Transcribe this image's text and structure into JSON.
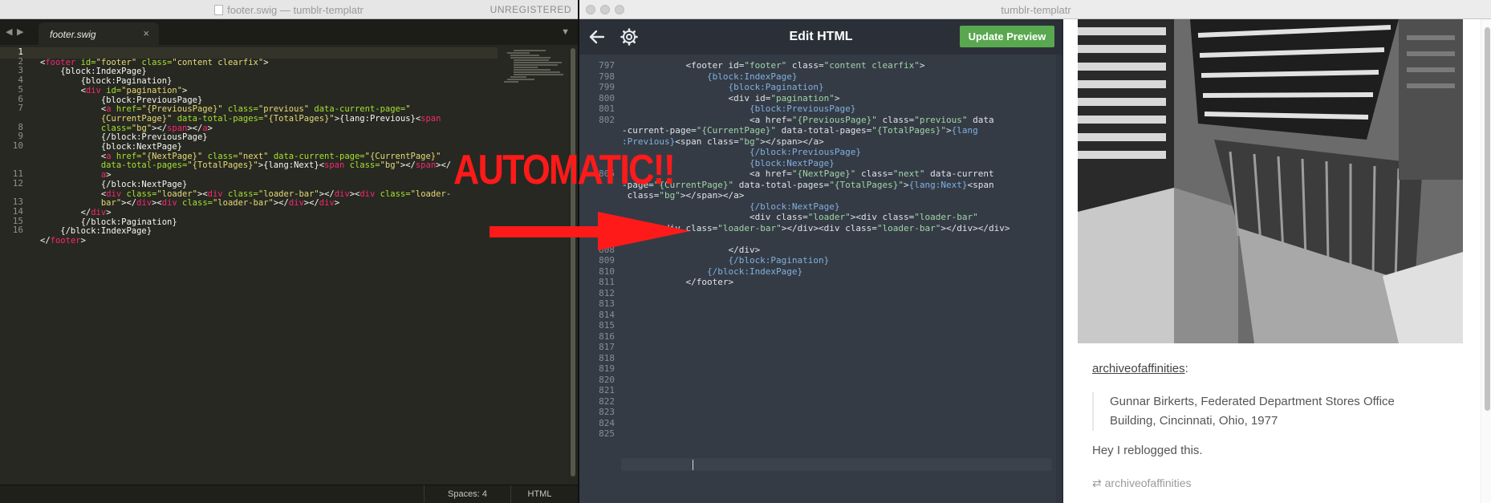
{
  "sublime": {
    "window_title": "footer.swig — tumblr-templatr",
    "unregistered": "UNREGISTERED",
    "tab_name": "footer.swig",
    "tab_close": "×",
    "nav_back": "◀",
    "nav_forward": "▶",
    "tab_menu": "▼",
    "line_numbers": [
      "1",
      "2",
      "3",
      "4",
      "5",
      "6",
      "7",
      "",
      "8",
      "9",
      "10",
      "",
      "",
      "11",
      "12",
      "",
      "13",
      "14",
      "15",
      "16"
    ],
    "code_lines": [
      [],
      [
        [
          "tx",
          "<"
        ],
        [
          "tg",
          "footer"
        ],
        [
          "at",
          " id="
        ],
        [
          "st",
          "\"footer\""
        ],
        [
          "at",
          " class="
        ],
        [
          "st",
          "\"content clearfix\""
        ],
        [
          "tx",
          ">"
        ]
      ],
      [
        [
          "tx",
          "    {block:IndexPage}"
        ]
      ],
      [
        [
          "tx",
          "        {block:Pagination}"
        ]
      ],
      [
        [
          "tx",
          "        <"
        ],
        [
          "tg",
          "div"
        ],
        [
          "at",
          " id="
        ],
        [
          "st",
          "\"pagination\""
        ],
        [
          "tx",
          ">"
        ]
      ],
      [
        [
          "tx",
          "            {block:PreviousPage}"
        ]
      ],
      [
        [
          "tx",
          "            <"
        ],
        [
          "tg",
          "a"
        ],
        [
          "at",
          " href="
        ],
        [
          "st",
          "\"{PreviousPage}\""
        ],
        [
          "at",
          " class="
        ],
        [
          "st",
          "\"previous\""
        ],
        [
          "at",
          " data-current-page="
        ],
        [
          "st",
          "\""
        ]
      ],
      [
        [
          "st",
          "            {CurrentPage}\""
        ],
        [
          "at",
          " data-total-pages="
        ],
        [
          "st",
          "\"{TotalPages}\""
        ],
        [
          "tx",
          ">{lang:Previous}<"
        ],
        [
          "tg",
          "span"
        ]
      ],
      [
        [
          "at",
          "            class="
        ],
        [
          "st",
          "\"bg\""
        ],
        [
          "tx",
          "></"
        ],
        [
          "tg",
          "span"
        ],
        [
          "tx",
          "></"
        ],
        [
          "tg",
          "a"
        ],
        [
          "tx",
          ">"
        ]
      ],
      [
        [
          "tx",
          "            {/block:PreviousPage}"
        ]
      ],
      [
        [
          "tx",
          "            {block:NextPage}"
        ]
      ],
      [
        [
          "tx",
          "            <"
        ],
        [
          "tg",
          "a"
        ],
        [
          "at",
          " href="
        ],
        [
          "st",
          "\"{NextPage}\""
        ],
        [
          "at",
          " class="
        ],
        [
          "st",
          "\"next\""
        ],
        [
          "at",
          " data-current-page="
        ],
        [
          "st",
          "\"{CurrentPage}\""
        ]
      ],
      [
        [
          "at",
          "            data-total-pages="
        ],
        [
          "st",
          "\"{TotalPages}\""
        ],
        [
          "tx",
          ">{lang:Next}<"
        ],
        [
          "tg",
          "span"
        ],
        [
          "at",
          " class="
        ],
        [
          "st",
          "\"bg\""
        ],
        [
          "tx",
          "></"
        ],
        [
          "tg",
          "span"
        ],
        [
          "tx",
          "></"
        ]
      ],
      [
        [
          "tg",
          "            a"
        ],
        [
          "tx",
          ">"
        ]
      ],
      [
        [
          "tx",
          "            {/block:NextPage}"
        ]
      ],
      [
        [
          "tx",
          "            <"
        ],
        [
          "tg",
          "div"
        ],
        [
          "at",
          " class="
        ],
        [
          "st",
          "\"loader\""
        ],
        [
          "tx",
          "><"
        ],
        [
          "tg",
          "div"
        ],
        [
          "at",
          " class="
        ],
        [
          "st",
          "\"loader-bar\""
        ],
        [
          "tx",
          "></"
        ],
        [
          "tg",
          "div"
        ],
        [
          "tx",
          "><"
        ],
        [
          "tg",
          "div"
        ],
        [
          "at",
          " class="
        ],
        [
          "st",
          "\"loader-"
        ]
      ],
      [
        [
          "st",
          "            bar\""
        ],
        [
          "tx",
          "></"
        ],
        [
          "tg",
          "div"
        ],
        [
          "tx",
          "><"
        ],
        [
          "tg",
          "div"
        ],
        [
          "at",
          " class="
        ],
        [
          "st",
          "\"loader-bar\""
        ],
        [
          "tx",
          "></"
        ],
        [
          "tg",
          "div"
        ],
        [
          "tx",
          "></"
        ],
        [
          "tg",
          "div"
        ],
        [
          "tx",
          ">"
        ]
      ],
      [
        [
          "tx",
          "        </"
        ],
        [
          "tg",
          "div"
        ],
        [
          "tx",
          ">"
        ]
      ],
      [
        [
          "tx",
          "        {/block:Pagination}"
        ]
      ],
      [
        [
          "tx",
          "    {/block:IndexPage}"
        ]
      ],
      [
        [
          "tx",
          "</"
        ],
        [
          "tg",
          "footer"
        ],
        [
          "tx",
          ">"
        ]
      ]
    ],
    "status_spaces": "Spaces: 4",
    "status_syntax": "HTML"
  },
  "templatr": {
    "window_title": "tumblr-templatr",
    "header_title": "Edit HTML",
    "update_button": "Update Preview",
    "line_numbers": [
      "797",
      "798",
      "799",
      "800",
      "801",
      "802",
      "",
      "",
      "",
      "",
      "805",
      "",
      "",
      "",
      "",
      "",
      "",
      "808",
      "809",
      "810",
      "811",
      "812",
      "813",
      "814",
      "815",
      "816",
      "817",
      "818",
      "819",
      "820",
      "821",
      "822",
      "823",
      "824",
      "825"
    ],
    "code_lines": [
      [
        [
          "ht",
          "            <footer id="
        ],
        [
          "hs",
          "\"footer\""
        ],
        [
          "ht",
          " class="
        ],
        [
          "hs",
          "\"content clearfix\""
        ],
        [
          "ht",
          ">"
        ]
      ],
      [
        [
          "hb",
          "                {block:IndexPage}"
        ]
      ],
      [
        [
          "hb",
          "                    {block:Pagination}"
        ]
      ],
      [
        [
          "ht",
          "                    <div id="
        ],
        [
          "hs",
          "\"pagination\""
        ],
        [
          "ht",
          ">"
        ]
      ],
      [
        [
          "hb",
          "                        {block:PreviousPage}"
        ]
      ],
      [
        [
          "ht",
          "                        <a href="
        ],
        [
          "hs",
          "\"{PreviousPage}\""
        ],
        [
          "ht",
          " class="
        ],
        [
          "hs",
          "\"previous\""
        ],
        [
          "ht",
          " data"
        ]
      ],
      [
        [
          "ht",
          "-current-page="
        ],
        [
          "hs",
          "\"{CurrentPage}\""
        ],
        [
          "ht",
          " data-total-pages="
        ],
        [
          "hs",
          "\"{TotalPages}\""
        ],
        [
          "ht",
          ">"
        ],
        [
          "hb",
          "{lang"
        ]
      ],
      [
        [
          "hb",
          ":Previous}"
        ],
        [
          "ht",
          "<span class="
        ],
        [
          "hs",
          "\"bg\""
        ],
        [
          "ht",
          "></span></a>"
        ]
      ],
      [
        [
          "hb",
          "                        {/block:PreviousPage}"
        ]
      ],
      [
        [
          "hb",
          "                        {block:NextPage}"
        ]
      ],
      [
        [
          "ht",
          "                        <a href="
        ],
        [
          "hs",
          "\"{NextPage}\""
        ],
        [
          "ht",
          " class="
        ],
        [
          "hs",
          "\"next\""
        ],
        [
          "ht",
          " data-current"
        ]
      ],
      [
        [
          "ht",
          "-page="
        ],
        [
          "hs",
          "\"{CurrentPage}\""
        ],
        [
          "ht",
          " data-total-pages="
        ],
        [
          "hs",
          "\"{TotalPages}\""
        ],
        [
          "ht",
          ">"
        ],
        [
          "hb",
          "{lang:Next}"
        ],
        [
          "ht",
          "<span"
        ]
      ],
      [
        [
          "ht",
          " class="
        ],
        [
          "hs",
          "\"bg\""
        ],
        [
          "ht",
          "></span></a>"
        ]
      ],
      [
        [
          "hb",
          "                        {/block:NextPage}"
        ]
      ],
      [
        [
          "ht",
          "                        <div class="
        ],
        [
          "hs",
          "\"loader\""
        ],
        [
          "ht",
          "><div class="
        ],
        [
          "hs",
          "\"loader-bar\""
        ]
      ],
      [
        [
          "ht",
          "></div><div class="
        ],
        [
          "hs",
          "\"loader-bar\""
        ],
        [
          "ht",
          "></div><div class="
        ],
        [
          "hs",
          "\"loader-bar\""
        ],
        [
          "ht",
          "></div></div>"
        ]
      ],
      [
        [
          "ht",
          ">"
        ]
      ],
      [
        [
          "ht",
          "                    </div>"
        ]
      ],
      [
        [
          "hb",
          "                    {/block:Pagination}"
        ]
      ],
      [
        [
          "hb",
          "                {/block:IndexPage}"
        ]
      ],
      [
        [
          "ht",
          "            </footer>"
        ]
      ]
    ],
    "preview": {
      "username": "archiveofaffinities",
      "colon": ":",
      "quote": "Gunnar Birkerts, Federated Department Stores Office Building, Cincinnati, Ohio, 1977",
      "comment": "Hey I reblogged this.",
      "reblog_icon": "⇄",
      "reblog_user": "archiveofaffinities"
    }
  },
  "overlay": {
    "caption": "AUTOMATIC!!",
    "color": "#ff1a1a"
  }
}
